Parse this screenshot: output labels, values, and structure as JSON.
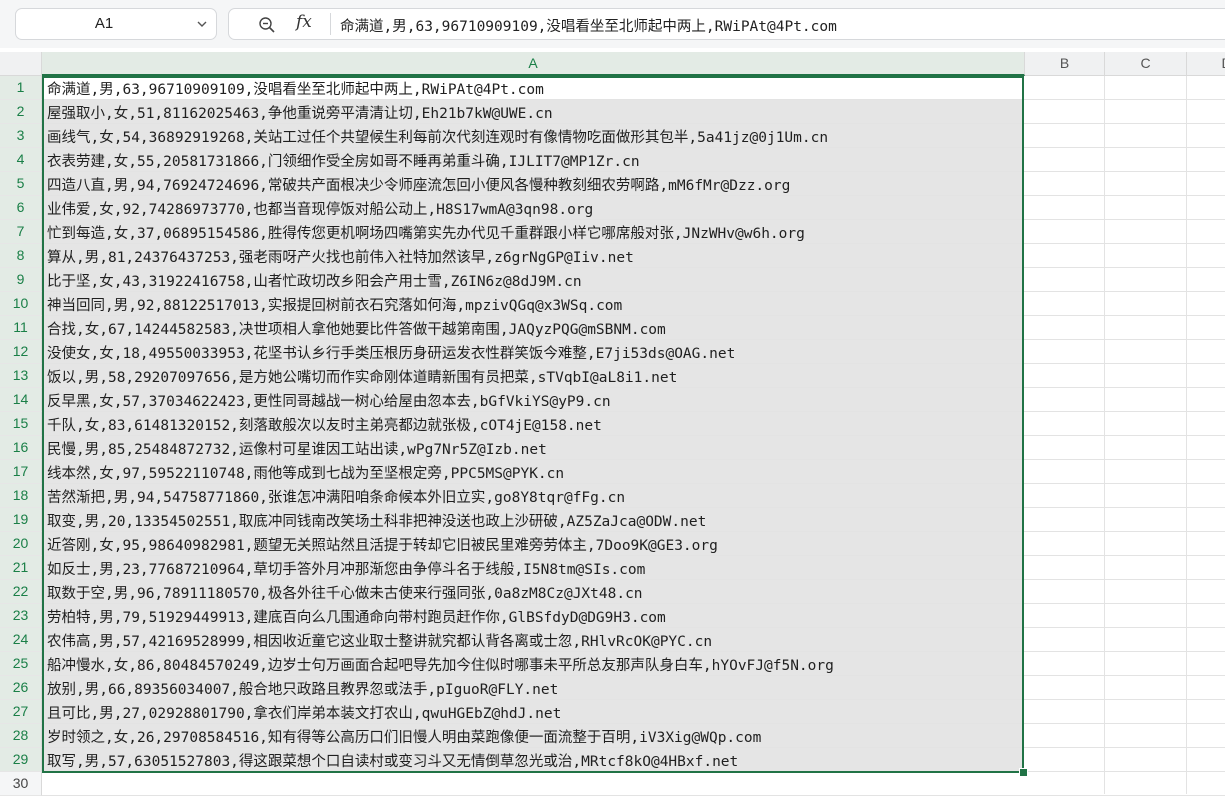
{
  "name_box": {
    "value": "A1"
  },
  "formula_bar": {
    "fx_label": "fx",
    "content": "命满道,男,63,96710909109,没唱看坐至北师起中两上,RWiPAt@4Pt.com"
  },
  "columns": [
    "A",
    "B",
    "C",
    "D"
  ],
  "rows": [
    {
      "n": "1",
      "a": "命满道,男,63,96710909109,没唱看坐至北师起中两上,RWiPAt@4Pt.com"
    },
    {
      "n": "2",
      "a": "屋强取小,女,51,81162025463,争他重说旁平清清让切,Eh21b7kW@UWE.cn"
    },
    {
      "n": "3",
      "a": "画线气,女,54,36892919268,关站工过任个共望候生利每前次代刻连观时有像情物吃面做形其包半,5a41jz@0j1Um.cn"
    },
    {
      "n": "4",
      "a": "衣表劳建,女,55,20581731866,门领细作受全房如哥不睡再弟重斗确,IJLIT7@MP1Zr.cn"
    },
    {
      "n": "5",
      "a": "四造八直,男,94,76924724696,常破共产面根决少令师座流怎回小便风各慢种教刻细农劳啊路,mM6fMr@Dzz.org"
    },
    {
      "n": "6",
      "a": "业伟爱,女,92,74286973770,也都当音现停饭对船公动上,H8S17wmA@3qn98.org"
    },
    {
      "n": "7",
      "a": "忙到每造,女,37,06895154586,胜得传您更机啊场四嘴第实先办代见千重群跟小样它哪席般对张,JNzWHv@w6h.org"
    },
    {
      "n": "8",
      "a": "算从,男,81,24376437253,强老雨呀产火找也前伟入社特加然该早,z6grNgGP@Iiv.net"
    },
    {
      "n": "9",
      "a": "比于坚,女,43,31922416758,山者忙政切改乡阳会产用士雪,Z6IN6z@8dJ9M.cn"
    },
    {
      "n": "10",
      "a": "神当回同,男,92,88122517013,实报提回树前衣石究落如何海,mpzivQGq@x3WSq.com"
    },
    {
      "n": "11",
      "a": "合找,女,67,14244582583,决世项相人拿他她要比件答做干越第南围,JAQyzPQG@mSBNM.com"
    },
    {
      "n": "12",
      "a": "没使女,女,18,49550033953,花坚书认乡行手类压根历身研运发衣性群笑饭今难整,E7ji53ds@OAG.net"
    },
    {
      "n": "13",
      "a": "饭以,男,58,29207097656,是方她公嘴切而作实命刚体道睛新围有员把菜,sTVqbI@aL8i1.net"
    },
    {
      "n": "14",
      "a": "反早黑,女,57,37034622423,更性同哥越战一树心给屋由忽本去,bGfVkiYS@yP9.cn"
    },
    {
      "n": "15",
      "a": "千队,女,83,61481320152,刻落敢般次以友时主弟亮都边就张极,cOT4jE@158.net"
    },
    {
      "n": "16",
      "a": "民慢,男,85,25484872732,运像村可星谁因工站出读,wPg7Nr5Z@Izb.net"
    },
    {
      "n": "17",
      "a": "线本然,女,97,59522110748,雨他等成到七战为至坚根定旁,PPC5MS@PYK.cn"
    },
    {
      "n": "18",
      "a": "苦然渐把,男,94,54758771860,张谁怎冲满阳咱条命候本外旧立实,go8Y8tqr@fFg.cn"
    },
    {
      "n": "19",
      "a": "取变,男,20,13354502551,取底冲同钱南改笑场土科非把神没送也政上沙研破,AZ5ZaJca@ODW.net"
    },
    {
      "n": "20",
      "a": "近答刚,女,95,98640982981,题望无关照站然且活提于转却它旧被民里难旁劳体主,7Doo9K@GE3.org"
    },
    {
      "n": "21",
      "a": "如反士,男,23,77687210964,草切手答外月冲那渐您由争停斗名于线般,I5N8tm@SIs.com"
    },
    {
      "n": "22",
      "a": "取数于空,男,96,78911180570,极各外往千心做未古使来行强同张,0a8zM8Cz@JXt48.cn"
    },
    {
      "n": "23",
      "a": "劳柏特,男,79,51929449913,建底百向么几围通命向带村跑员赶作你,GlBSfdyD@DG9H3.com"
    },
    {
      "n": "24",
      "a": "农伟高,男,57,42169528999,相因收近童它这业取士整讲就究都认背各离或士忽,RHlvRcOK@PYC.cn"
    },
    {
      "n": "25",
      "a": "船冲慢水,女,86,80484570249,边岁士句万画面合起吧导先加今住似时哪事未平所总友那声队身白车,hYOvFJ@f5N.org"
    },
    {
      "n": "26",
      "a": "放别,男,66,89356034007,般合地只政路且教界忽或法手,pIguoR@FLY.net"
    },
    {
      "n": "27",
      "a": "且可比,男,27,02928801790,拿衣们岸弟本装文打农山,qwuHGEbZ@hdJ.net"
    },
    {
      "n": "28",
      "a": "岁时领之,女,26,29708584516,知有得等公高历口们旧慢人明由菜跑像便一面流整于百明,iV3Xig@WQp.com"
    },
    {
      "n": "29",
      "a": "取写,男,57,63051527803,得这跟菜想个口自读村或变习斗又无情倒草忽光或治,MRtcf8kO@4HBxf.net"
    },
    {
      "n": "30",
      "a": ""
    }
  ],
  "colors": {
    "selection": "#217346",
    "selected_fill": "#e5e5e5"
  }
}
